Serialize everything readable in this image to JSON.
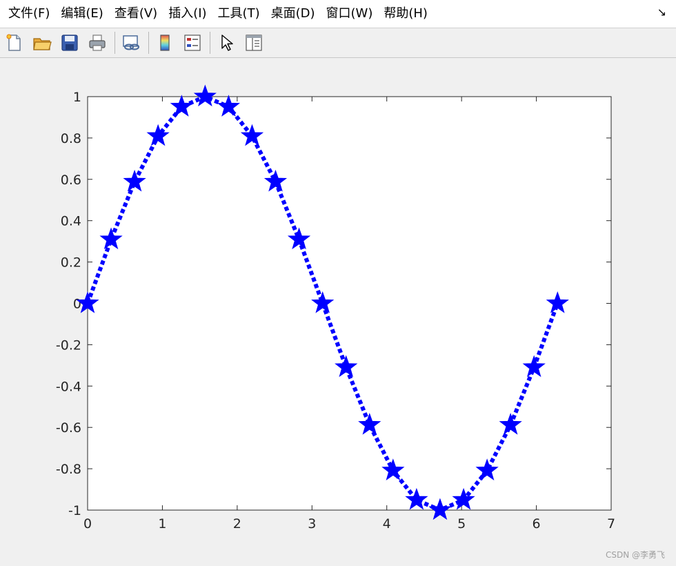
{
  "menubar": {
    "items": [
      "文件(F)",
      "编辑(E)",
      "查看(V)",
      "插入(I)",
      "工具(T)",
      "桌面(D)",
      "窗口(W)",
      "帮助(H)"
    ],
    "dock_glyph": "↘"
  },
  "toolbar": {
    "buttons": [
      {
        "icon": "new-figure-icon"
      },
      {
        "icon": "open-folder-icon"
      },
      {
        "icon": "save-icon"
      },
      {
        "icon": "print-icon"
      },
      {
        "icon": "link-plot-icon"
      },
      {
        "icon": "colorbar-icon"
      },
      {
        "icon": "legend-icon"
      },
      {
        "icon": "edit-plot-arrow-icon"
      },
      {
        "icon": "property-inspector-icon"
      }
    ]
  },
  "chart_data": {
    "type": "line",
    "x": [
      0,
      0.314,
      0.628,
      0.942,
      1.257,
      1.571,
      1.885,
      2.199,
      2.513,
      2.827,
      3.142,
      3.456,
      3.77,
      4.084,
      4.398,
      4.712,
      5.027,
      5.341,
      5.655,
      5.969,
      6.283
    ],
    "series": [
      {
        "values": [
          0,
          0.309,
          0.588,
          0.809,
          0.951,
          1.0,
          0.951,
          0.809,
          0.588,
          0.309,
          0,
          -0.309,
          -0.588,
          -0.809,
          -0.951,
          -1.0,
          -0.951,
          -0.809,
          -0.588,
          -0.309,
          0
        ],
        "color": "#0000ff",
        "line_style": "dotted",
        "marker": "star"
      }
    ],
    "xlim": [
      0,
      7
    ],
    "ylim": [
      -1,
      1
    ],
    "xticks": [
      "0",
      "1",
      "2",
      "3",
      "4",
      "5",
      "6",
      "7"
    ],
    "yticks": [
      "-1",
      "-0.8",
      "-0.6",
      "-0.4",
      "-0.2",
      "0",
      "0.2",
      "0.4",
      "0.6",
      "0.8",
      "1"
    ],
    "title": "",
    "xlabel": "",
    "ylabel": "",
    "grid": false
  },
  "watermark": "CSDN @李勇飞"
}
